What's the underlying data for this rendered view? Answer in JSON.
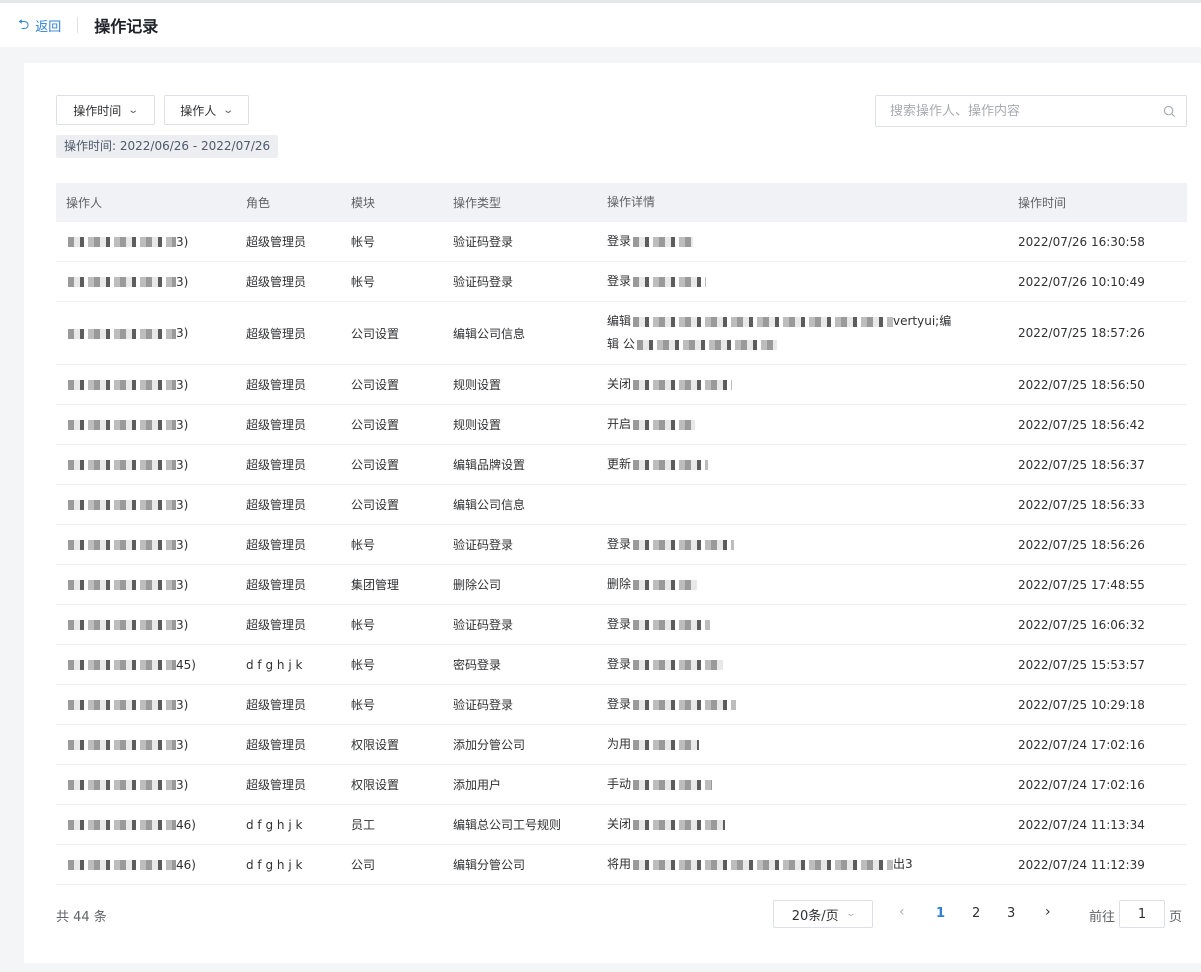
{
  "header": {
    "back_label": "返回",
    "title": "操作记录"
  },
  "filters": {
    "time_label": "操作时间",
    "operator_label": "操作人",
    "search_placeholder": "搜索操作人、操作内容",
    "active_tag": "操作时间: 2022/06/26 - 2022/07/26"
  },
  "table": {
    "columns": [
      "操作人",
      "角色",
      "模块",
      "操作类型",
      "操作详情",
      "操作时间"
    ],
    "rows": [
      {
        "operator": "3)",
        "role": "超级管理员",
        "module": "帐号",
        "type": "验证码登录",
        "detail": "登录",
        "time": "2022/07/26 16:30:58"
      },
      {
        "operator": "3)",
        "role": "超级管理员",
        "module": "帐号",
        "type": "验证码登录",
        "detail": "登录",
        "time": "2022/07/26 10:10:49"
      },
      {
        "operator": "3)",
        "role": "超级管理员",
        "module": "公司设置",
        "type": "编辑公司信息",
        "detail": "编辑",
        "detail_tail": "vertyui;编",
        "detail_line2": "辑 公",
        "time": "2022/07/25 18:57:26"
      },
      {
        "operator": "3)",
        "role": "超级管理员",
        "module": "公司设置",
        "type": "规则设置",
        "detail": "关闭",
        "time": "2022/07/25 18:56:50"
      },
      {
        "operator": "3)",
        "role": "超级管理员",
        "module": "公司设置",
        "type": "规则设置",
        "detail": "开启",
        "time": "2022/07/25 18:56:42"
      },
      {
        "operator": "3)",
        "role": "超级管理员",
        "module": "公司设置",
        "type": "编辑品牌设置",
        "detail": "更新",
        "time": "2022/07/25 18:56:37"
      },
      {
        "operator": "3)",
        "role": "超级管理员",
        "module": "公司设置",
        "type": "编辑公司信息",
        "detail": "",
        "time": "2022/07/25 18:56:33"
      },
      {
        "operator": "3)",
        "role": "超级管理员",
        "module": "帐号",
        "type": "验证码登录",
        "detail": "登录",
        "time": "2022/07/25 18:56:26"
      },
      {
        "operator": "3)",
        "role": "超级管理员",
        "module": "集团管理",
        "type": "删除公司",
        "detail": "删除",
        "time": "2022/07/25 17:48:55"
      },
      {
        "operator": "3)",
        "role": "超级管理员",
        "module": "帐号",
        "type": "验证码登录",
        "detail": "登录",
        "time": "2022/07/25 16:06:32"
      },
      {
        "operator": "45)",
        "role": "d f g h j k",
        "module": "帐号",
        "type": "密码登录",
        "detail": "登录",
        "time": "2022/07/25 15:53:57"
      },
      {
        "operator": "3)",
        "role": "超级管理员",
        "module": "帐号",
        "type": "验证码登录",
        "detail": "登录",
        "time": "2022/07/25 10:29:18"
      },
      {
        "operator": "3)",
        "role": "超级管理员",
        "module": "权限设置",
        "type": "添加分管公司",
        "detail": "为用",
        "time": "2022/07/24 17:02:16"
      },
      {
        "operator": "3)",
        "role": "超级管理员",
        "module": "权限设置",
        "type": "添加用户",
        "detail": "手动",
        "time": "2022/07/24 17:02:16"
      },
      {
        "operator": "46)",
        "role": "d f g h j k",
        "module": "员工",
        "type": "编辑总公司工号规则",
        "detail": "关闭",
        "time": "2022/07/24 11:13:34"
      },
      {
        "operator": "46)",
        "role": "d f g h j k",
        "module": "公司",
        "type": "编辑分管公司",
        "detail": "将用",
        "detail_tail": "出3",
        "time": "2022/07/24 11:12:39"
      }
    ]
  },
  "pagination": {
    "total_text": "共 44 条",
    "page_size": "20条/页",
    "pages": [
      "1",
      "2",
      "3"
    ],
    "current": "1",
    "goto_label": "前往",
    "goto_value": "1",
    "goto_suffix": "页"
  },
  "colors": {
    "accent": "#2f7fd6",
    "header_bg": "#f1f2f5",
    "page_bg": "#f4f5f7"
  }
}
